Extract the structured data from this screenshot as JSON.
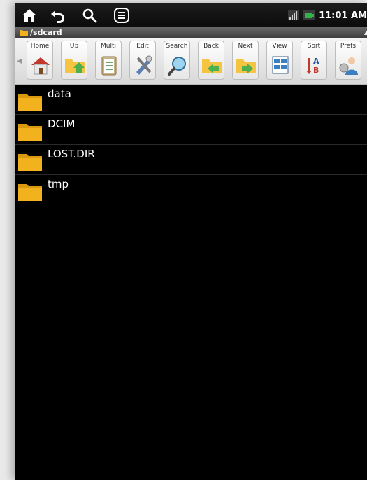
{
  "status_bar": {
    "time": "11:01 AM",
    "icons": [
      "home-icon",
      "back-icon",
      "search-icon",
      "menu-icon",
      "signal-icon",
      "battery-icon"
    ]
  },
  "path_bar": {
    "path": "/sdcard"
  },
  "toolbar": {
    "buttons": [
      {
        "label": "Home",
        "icon": "house-icon"
      },
      {
        "label": "Up",
        "icon": "folder-up-icon"
      },
      {
        "label": "Multi",
        "icon": "clipboard-icon"
      },
      {
        "label": "Edit",
        "icon": "tools-icon"
      },
      {
        "label": "Search",
        "icon": "magnifier-icon"
      },
      {
        "label": "Back",
        "icon": "folder-back-icon"
      },
      {
        "label": "Next",
        "icon": "folder-next-icon"
      },
      {
        "label": "View",
        "icon": "view-icon"
      },
      {
        "label": "Sort",
        "icon": "sort-icon"
      },
      {
        "label": "Prefs",
        "icon": "prefs-icon"
      }
    ]
  },
  "files": [
    {
      "name": "data",
      "icon": "folder-icon"
    },
    {
      "name": "DCIM",
      "icon": "folder-icon"
    },
    {
      "name": "LOST.DIR",
      "icon": "folder-icon"
    },
    {
      "name": "tmp",
      "icon": "folder-icon"
    }
  ],
  "colors": {
    "folder": "#f2b21d",
    "status_bg": "#111111",
    "list_bg": "#000000"
  }
}
